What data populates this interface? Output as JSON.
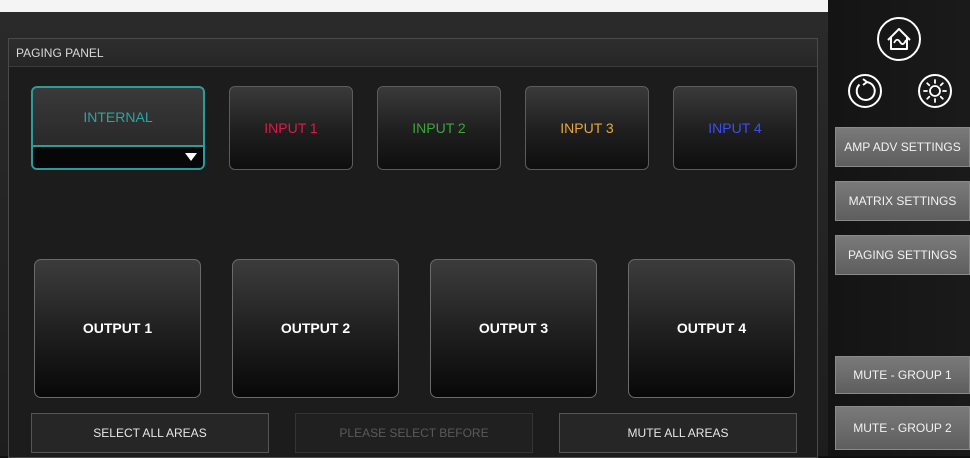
{
  "panel": {
    "title": "PAGING PANEL"
  },
  "sources": {
    "internal": {
      "label": "INTERNAL",
      "color": "#2aa6a0"
    },
    "inputs": [
      {
        "label": "INPUT 1",
        "color": "#e0174a"
      },
      {
        "label": "INPUT 2",
        "color": "#3aa63a"
      },
      {
        "label": "INPUT 3",
        "color": "#e8a53a"
      },
      {
        "label": "INPUT 4",
        "color": "#3a4ff0"
      }
    ]
  },
  "outputs": [
    {
      "label": "OUTPUT 1"
    },
    {
      "label": "OUTPUT 2"
    },
    {
      "label": "OUTPUT 3"
    },
    {
      "label": "OUTPUT 4"
    }
  ],
  "bottom_actions": {
    "select_all": "SELECT ALL AREAS",
    "please_select": "PLEASE SELECT BEFORE",
    "mute_all": "MUTE ALL AREAS"
  },
  "sidebar": {
    "icons": [
      "home-icon",
      "refresh-icon",
      "brightness-icon"
    ],
    "buttons": {
      "amp_adv": "AMP ADV SETTINGS",
      "matrix": "MATRIX SETTINGS",
      "paging": "PAGING SETTINGS",
      "mute_group_1": "MUTE - GROUP 1",
      "mute_group_2": "MUTE - GROUP 2"
    }
  }
}
